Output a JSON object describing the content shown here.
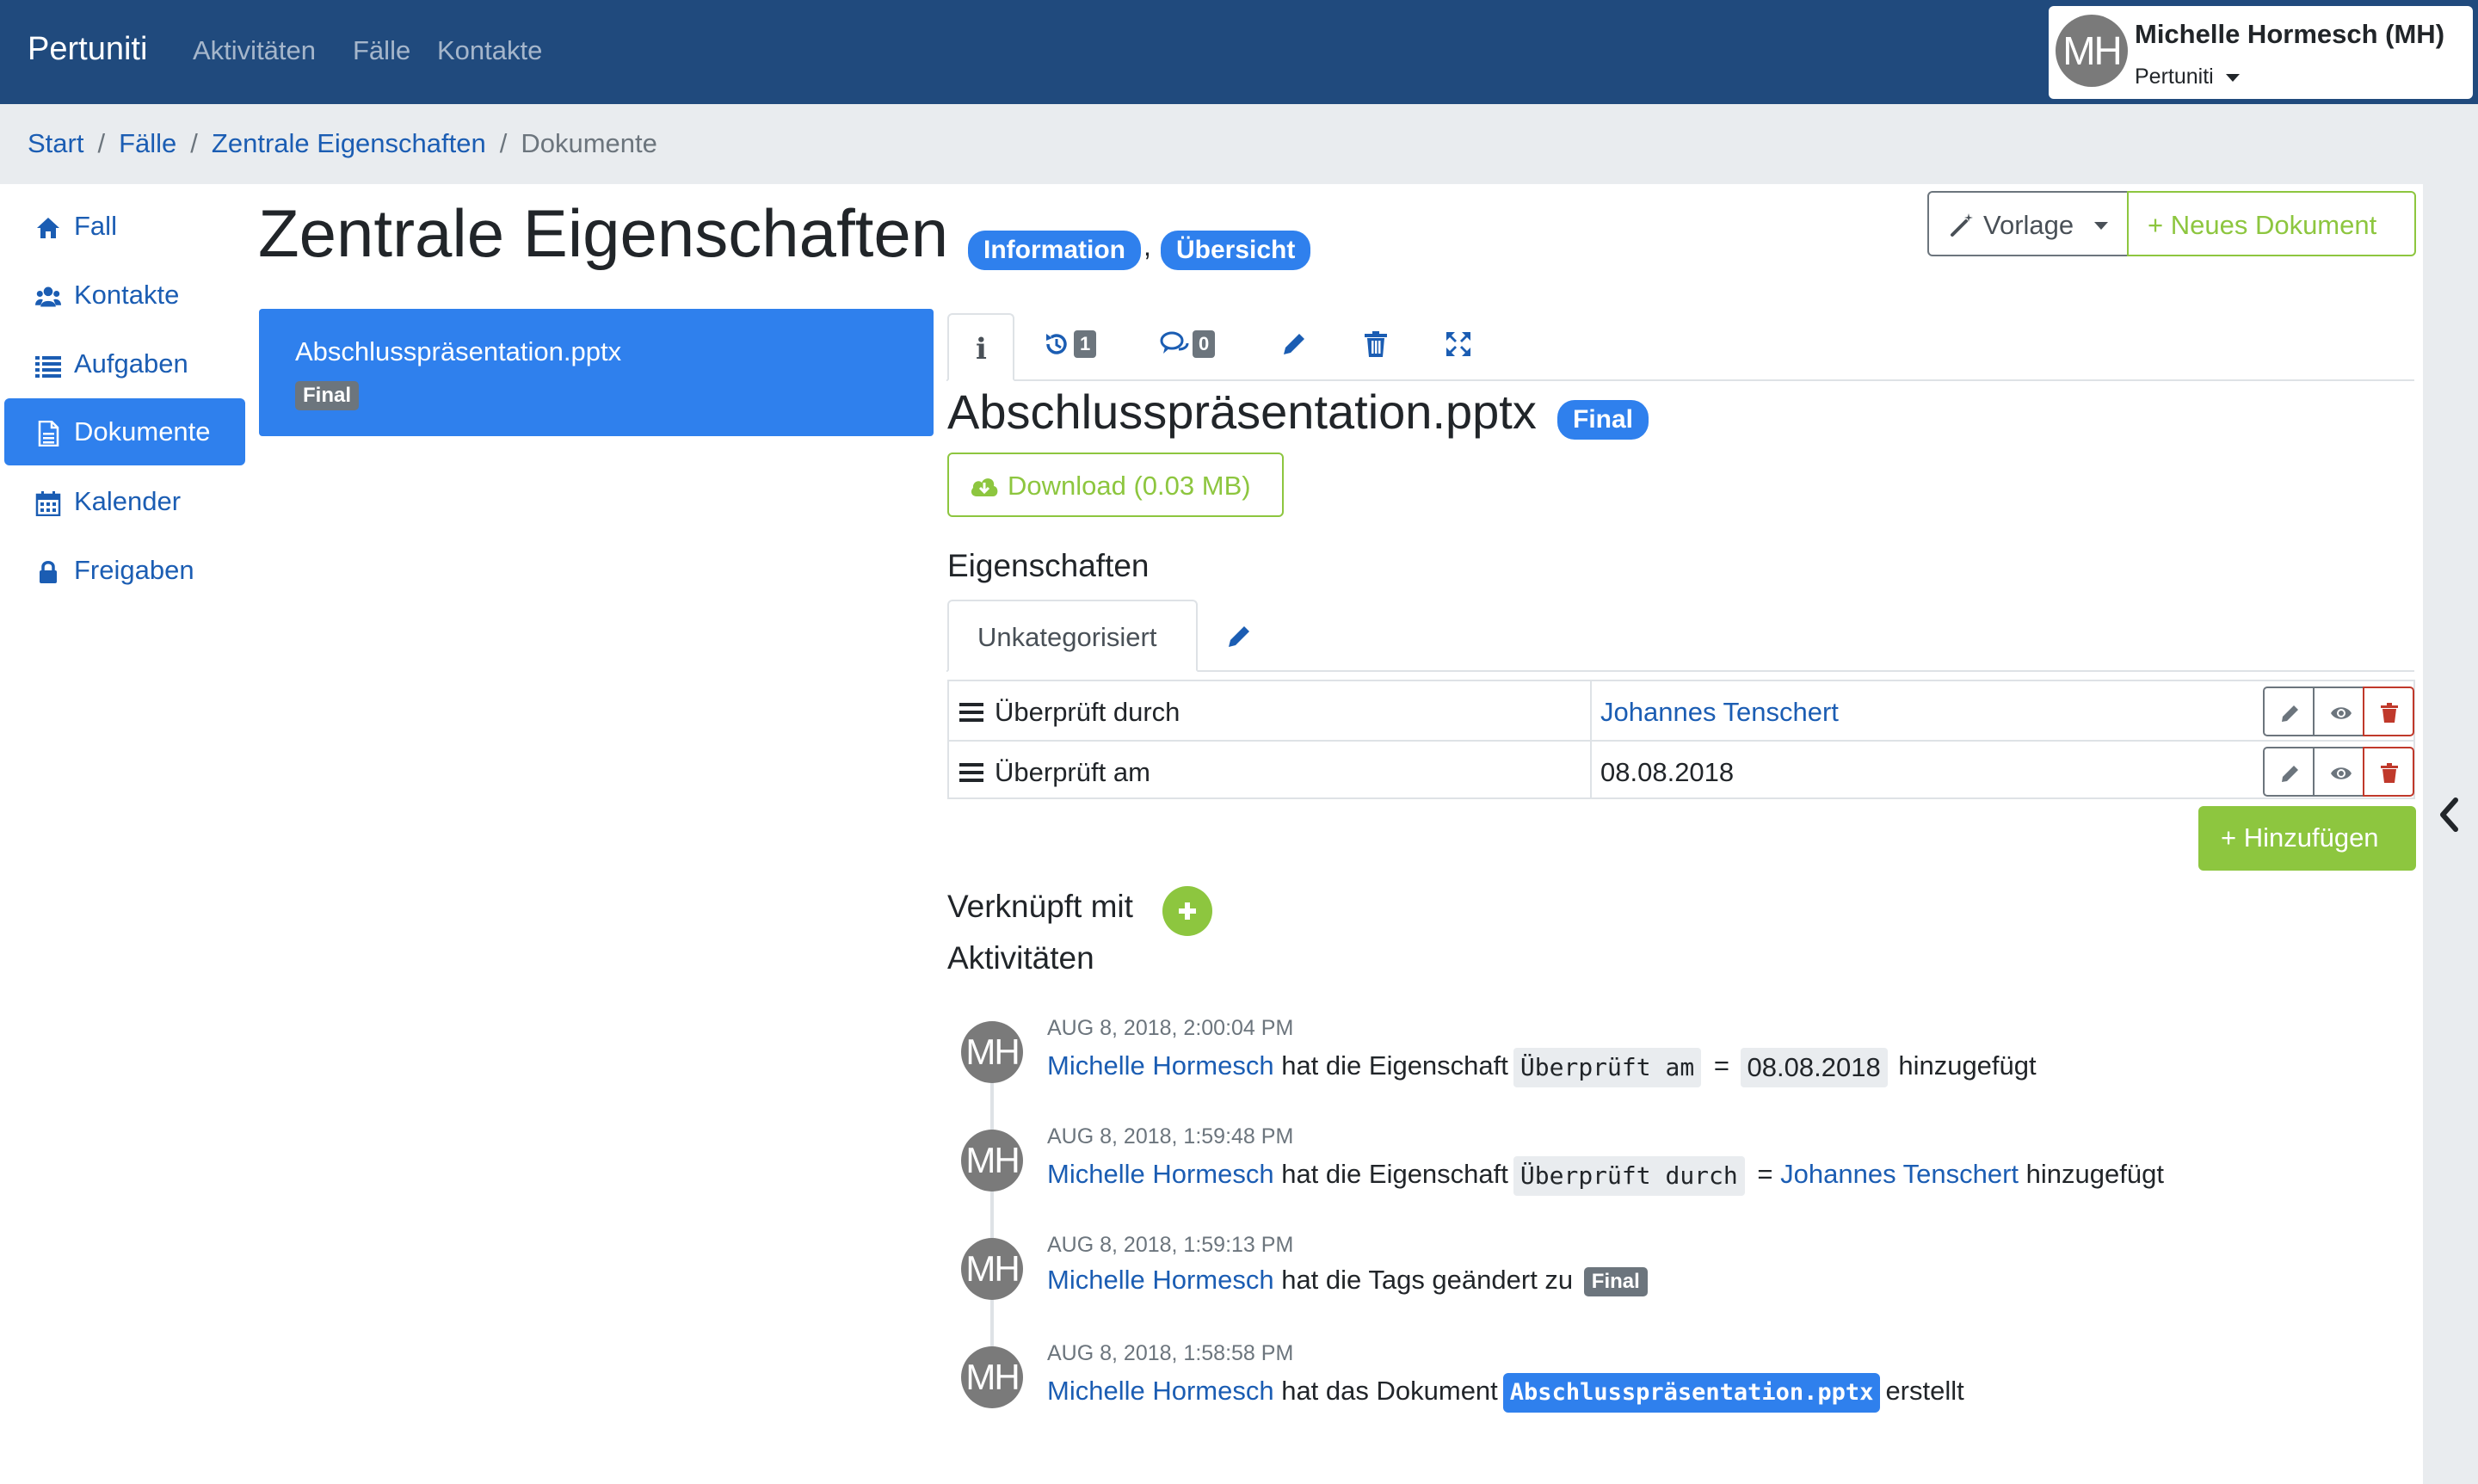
{
  "navbar": {
    "brand": "Pertuniti",
    "links": [
      "Aktivitäten",
      "Fälle",
      "Kontakte"
    ],
    "user": {
      "initials": "MH",
      "name": "Michelle Hormesch (MH)",
      "org": "Pertuniti"
    }
  },
  "breadcrumb": {
    "items": [
      "Start",
      "Fälle",
      "Zentrale Eigenschaften"
    ],
    "separator": "/",
    "active": "Dokumente"
  },
  "sidebar": {
    "items": [
      {
        "label": "Fall",
        "icon": "home-icon"
      },
      {
        "label": "Kontakte",
        "icon": "users-icon"
      },
      {
        "label": "Aufgaben",
        "icon": "list-icon"
      },
      {
        "label": "Dokumente",
        "icon": "document-icon",
        "active": true
      },
      {
        "label": "Kalender",
        "icon": "calendar-icon"
      },
      {
        "label": "Freigaben",
        "icon": "lock-icon"
      }
    ]
  },
  "header": {
    "title": "Zentrale Eigenschaften",
    "badges": [
      "Information",
      "Übersicht"
    ],
    "comma": ",",
    "vorlage_label": "Vorlage",
    "new_document_label": "+ Neues Dokument"
  },
  "doc_list": {
    "items": [
      {
        "name": "Abschlusspräsentation.pptx",
        "tag": "Final"
      }
    ]
  },
  "tabs": {
    "info_label": "i",
    "history_count": "1",
    "comments_count": "0"
  },
  "document": {
    "title": "Abschlusspräsentation.pptx",
    "tag": "Final",
    "download_label": "Download (0.03 MB)"
  },
  "properties": {
    "heading": "Eigenschaften",
    "category_tab": "Unkategorisiert",
    "rows": [
      {
        "key": "Überprüft durch",
        "value": "Johannes Tenschert",
        "is_link": true
      },
      {
        "key": "Überprüft am",
        "value": "08.08.2018",
        "is_link": false
      }
    ],
    "add_label": "+ Hinzufügen"
  },
  "linked": {
    "heading": "Verknüpft mit"
  },
  "activities": {
    "heading": "Aktivitäten",
    "items": [
      {
        "initials": "MH",
        "time": "AUG 8, 2018, 2:00:04 PM",
        "user": "Michelle Hormesch",
        "text1": "hat die Eigenschaft",
        "code": "Überprüft am",
        "eq": "=",
        "value": "08.08.2018",
        "text2": "hinzugefügt"
      },
      {
        "initials": "MH",
        "time": "AUG 8, 2018, 1:59:48 PM",
        "user": "Michelle Hormesch",
        "text1": "hat die Eigenschaft",
        "code": "Überprüft durch",
        "eq": "=",
        "value": "Johannes Tenschert",
        "text2": "hinzugefügt"
      },
      {
        "initials": "MH",
        "time": "AUG 8, 2018, 1:59:13 PM",
        "user": "Michelle Hormesch",
        "text1": "hat die Tags geändert zu",
        "tag": "Final"
      },
      {
        "initials": "MH",
        "time": "AUG 8, 2018, 1:58:58 PM",
        "user": "Michelle Hormesch",
        "text1": "hat das Dokument",
        "code": "Abschlusspräsentation.pptx",
        "text2": "erstellt"
      }
    ]
  },
  "colors": {
    "navbar": "#204a7d",
    "primary": "#2f80ed",
    "link": "#1b5db3",
    "success": "#8dc63f",
    "danger": "#c0392b",
    "muted": "#6c757d",
    "light": "#e9ecef"
  }
}
